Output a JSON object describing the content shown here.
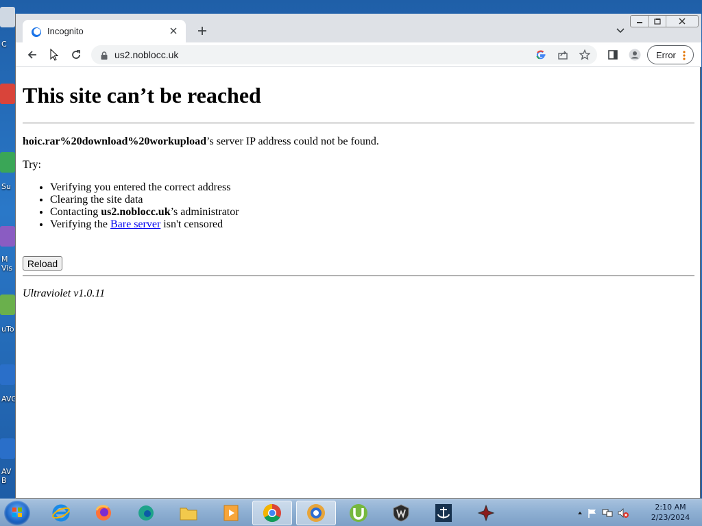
{
  "desktop": {
    "icon_labels": [
      "C",
      "Su",
      "M\nVis",
      "uTo",
      "AVG",
      "AV\nB"
    ]
  },
  "browser": {
    "tab": {
      "title": "Incognito"
    },
    "address_bar": {
      "url": "us2.noblocc.uk"
    },
    "error_chip": {
      "label": "Error"
    }
  },
  "page": {
    "heading": "This site can’t be reached",
    "host": "hoic.rar%20download%20workupload",
    "host_suffix": "’s server IP address could not be found.",
    "try_label": "Try:",
    "tips": {
      "t1": "Verifying you entered the correct address",
      "t2": "Clearing the site data",
      "t3_prefix": "Contacting ",
      "t3_bold": "us2.noblocc.uk",
      "t3_suffix": "’s administrator",
      "t4_prefix": "Verifying the ",
      "t4_link": "Bare server",
      "t4_suffix": " isn't censored"
    },
    "reload_label": "Reload",
    "footer": "Ultraviolet v1.0.11"
  },
  "taskbar": {
    "apps": [
      "internet-explorer",
      "firefox",
      "edge",
      "file-explorer",
      "media-player",
      "chrome",
      "incognito-browser",
      "utorrent",
      "world-of-tanks",
      "world-of-warships",
      "game"
    ],
    "active_app": "chrome",
    "clock": {
      "time": "2:10 AM",
      "date": "2/23/2024"
    }
  },
  "colors": {
    "link": "#0000ee",
    "titlebar": "#dee1e6",
    "omnibox": "#f1f3f4"
  }
}
